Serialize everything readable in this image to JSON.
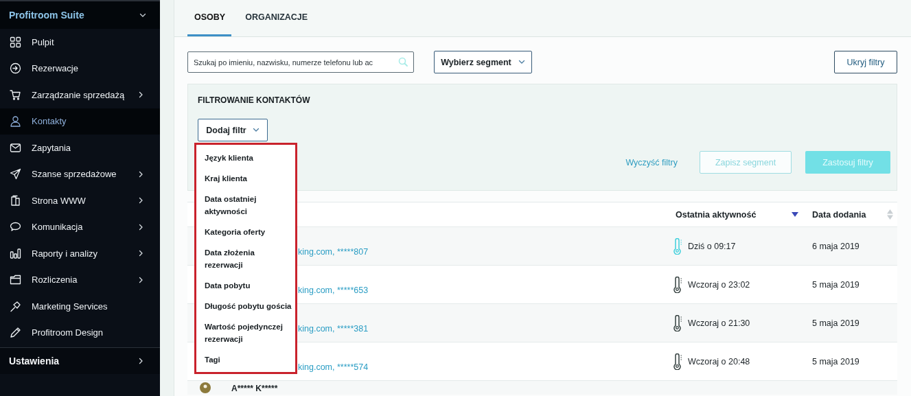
{
  "sidebar": {
    "title": "Profitroom Suite",
    "expanded": true,
    "items": [
      {
        "label": "Pulpit",
        "submenu": false,
        "selected": false
      },
      {
        "label": "Rezerwacje",
        "submenu": false,
        "selected": false
      },
      {
        "label": "Zarządzanie sprzedażą",
        "submenu": true,
        "selected": false
      },
      {
        "label": "Kontakty",
        "submenu": false,
        "selected": true
      },
      {
        "label": "Zapytania",
        "submenu": false,
        "selected": false
      },
      {
        "label": "Szanse sprzedażowe",
        "submenu": true,
        "selected": false
      },
      {
        "label": "Strona WWW",
        "submenu": true,
        "selected": false
      },
      {
        "label": "Komunikacja",
        "submenu": true,
        "selected": false
      },
      {
        "label": "Raporty i analizy",
        "submenu": true,
        "selected": false
      },
      {
        "label": "Rozliczenia",
        "submenu": true,
        "selected": false
      },
      {
        "label": "Marketing Services",
        "submenu": false,
        "selected": false
      },
      {
        "label": "Profitroom Design",
        "submenu": false,
        "selected": false
      }
    ],
    "footer": {
      "label": "Ustawienia",
      "submenu": true
    }
  },
  "tabs": [
    {
      "label": "OSOBY",
      "selected": true
    },
    {
      "label": "ORGANIZACJE",
      "selected": false
    }
  ],
  "search": {
    "placeholder": "Szukaj po imieniu, nazwisku, numerze telefonu lub ac"
  },
  "segment_dropdown": {
    "label": "Wybierz segment"
  },
  "hide_filters_button": "Ukryj filtry",
  "filters": {
    "title": "FILTROWANIE KONTAKTÓW",
    "add_filter": {
      "label": "Dodaj filtr",
      "expanded": true
    },
    "menu": [
      "Język klienta",
      "Kraj klienta",
      "Data ostatniej aktywności",
      "Kategoria oferty",
      "Data złożenia rezerwacji",
      "Data pobytu",
      "Długość pobytu gościa",
      "Wartość pojedynczej rezerwacji",
      "Tagi"
    ],
    "clear_link": "Wyczyść filtry",
    "buttons": [
      {
        "label": "Zapisz segment",
        "kind": "outline",
        "disabled": true
      },
      {
        "label": "Zastosuj filtry",
        "kind": "primary",
        "disabled": true
      }
    ]
  },
  "table": {
    "columns": [
      {
        "label": "Ostatnia aktywność",
        "sorted": true
      },
      {
        "label": "Data dodania",
        "sorted": false
      }
    ],
    "rows": [
      {
        "contact": "king.com, *****807",
        "activity": "Dziś o 09:17",
        "hot": true,
        "added": "6 maja 2019"
      },
      {
        "contact": "king.com, *****653",
        "activity": "Wczoraj o 23:02",
        "hot": false,
        "added": "5 maja 2019"
      },
      {
        "contact": "king.com, *****381",
        "activity": "Wczoraj o 21:30",
        "hot": false,
        "added": "5 maja 2019"
      },
      {
        "contact": "king.com, *****574",
        "activity": "Wczoraj o 20:48",
        "hot": false,
        "added": "5 maja 2019"
      },
      {
        "name": "A***** K*****"
      }
    ]
  }
}
